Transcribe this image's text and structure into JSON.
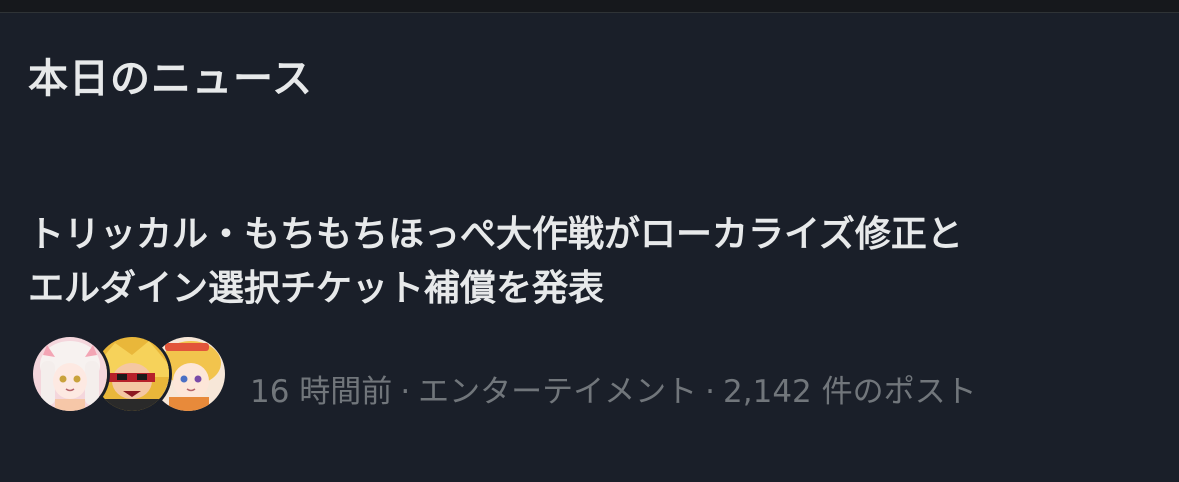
{
  "section": {
    "title": "本日のニュース"
  },
  "story": {
    "headline_line1": "トリッカル・もちもちほっぺ大作戦がローカライズ修正と",
    "headline_line2": "エルダイン選択チケット補償を発表",
    "time": "16 時間前",
    "separator": "·",
    "category": "エンターテイメント",
    "post_count": "2,142 件のポスト",
    "avatars": [
      "avatar-white-hair-girl",
      "avatar-blonde-red-character",
      "avatar-blonde-girl"
    ]
  },
  "colors": {
    "background": "#1a1f29",
    "title_text": "#e7e9ea",
    "meta_text": "#71767b"
  }
}
